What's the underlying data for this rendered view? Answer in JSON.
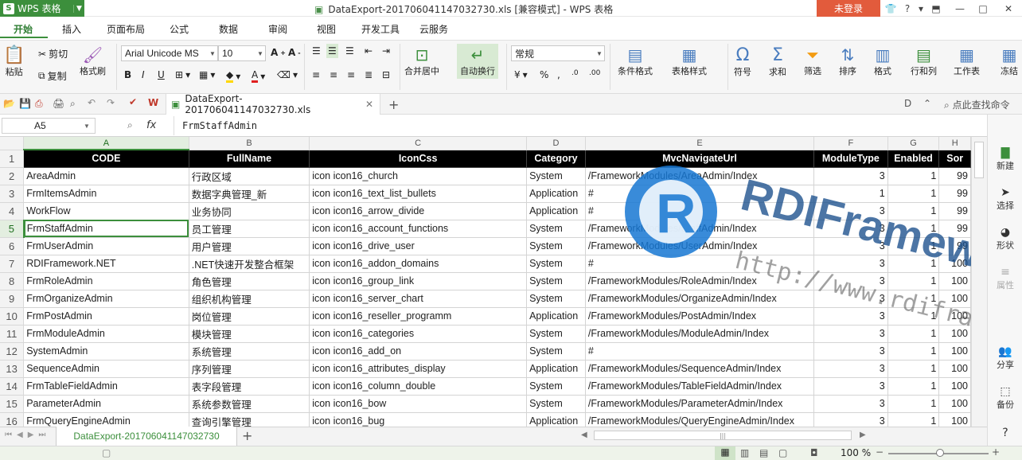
{
  "app": {
    "name": "WPS 表格",
    "title": "DataExport-201706041147032730.xls [兼容模式] - WPS 表格",
    "login": "未登录"
  },
  "ribbon_tabs": [
    "开始",
    "插入",
    "页面布局",
    "公式",
    "数据",
    "审阅",
    "视图",
    "开发工具",
    "云服务"
  ],
  "ribbon": {
    "paste": "粘贴",
    "cut": "剪切",
    "copy": "复制",
    "format_painter": "格式刷",
    "font_name": "Arial Unicode MS",
    "font_size": "10",
    "merge_center": "合并居中",
    "wrap_text": "自动换行",
    "number_format": "常规",
    "conditional_format": "条件格式",
    "table_style": "表格样式",
    "symbol": "符号",
    "sum": "求和",
    "filter": "筛选",
    "sort": "排序",
    "format": "格式",
    "row_col": "行和列",
    "worksheet": "工作表",
    "freeze": "冻结"
  },
  "toolbar": {
    "file_tab": "DataExport-201706041147032730.xls",
    "find_command": "点此查找命令"
  },
  "formula_bar": {
    "cell_ref": "A5",
    "fx": "fx",
    "value": "FrmStaffAdmin"
  },
  "columns": [
    "A",
    "B",
    "C",
    "D",
    "E",
    "F",
    "G",
    "H"
  ],
  "headers": [
    "CODE",
    "FullName",
    "IconCss",
    "Category",
    "MvcNavigateUrl",
    "ModuleType",
    "Enabled",
    "Sor"
  ],
  "rows": [
    [
      "AreaAdmin",
      "行政区域",
      "icon icon16_church",
      "System",
      "/FrameworkModules/AreaAdmin/Index",
      "3",
      "1",
      "99"
    ],
    [
      "FrmItemsAdmin",
      "数据字典管理_新",
      "icon icon16_text_list_bullets",
      "Application",
      "#",
      "1",
      "1",
      "99"
    ],
    [
      "WorkFlow",
      "业务协同",
      "icon icon16_arrow_divide",
      "Application",
      "#",
      "3",
      "1",
      "99"
    ],
    [
      "FrmStaffAdmin",
      "员工管理",
      "icon icon16_account_functions",
      "System",
      "/FrameworkModules/StaffAdmin/Index",
      "3",
      "1",
      "99"
    ],
    [
      "FrmUserAdmin",
      "用户管理",
      "icon icon16_drive_user",
      "System",
      "/FrameworkModules/UserAdmin/Index",
      "3",
      "1",
      "99"
    ],
    [
      "RDIFramework.NET",
      ".NET快速开发整合框架",
      "icon icon16_addon_domains",
      "System",
      "#",
      "3",
      "1",
      "100"
    ],
    [
      "FrmRoleAdmin",
      "角色管理",
      "icon icon16_group_link",
      "System",
      "/FrameworkModules/RoleAdmin/Index",
      "3",
      "1",
      "100"
    ],
    [
      "FrmOrganizeAdmin",
      "组织机构管理",
      "icon icon16_server_chart",
      "System",
      "/FrameworkModules/OrganizeAdmin/Index",
      "3",
      "1",
      "100"
    ],
    [
      "FrmPostAdmin",
      "岗位管理",
      "icon icon16_reseller_programm",
      "Application",
      "/FrameworkModules/PostAdmin/Index",
      "3",
      "1",
      "100"
    ],
    [
      "FrmModuleAdmin",
      "模块管理",
      "icon icon16_categories",
      "System",
      "/FrameworkModules/ModuleAdmin/Index",
      "3",
      "1",
      "100"
    ],
    [
      "SystemAdmin",
      "系统管理",
      "icon icon16_add_on",
      "System",
      "#",
      "3",
      "1",
      "100"
    ],
    [
      "SequenceAdmin",
      "序列管理",
      "icon icon16_attributes_display",
      "Application",
      "/FrameworkModules/SequenceAdmin/Index",
      "3",
      "1",
      "100"
    ],
    [
      "FrmTableFieldAdmin",
      "表字段管理",
      "icon icon16_column_double",
      "System",
      "/FrameworkModules/TableFieldAdmin/Index",
      "3",
      "1",
      "100"
    ],
    [
      "ParameterAdmin",
      "系统参数管理",
      "icon icon16_bow",
      "System",
      "/FrameworkModules/ParameterAdmin/Index",
      "3",
      "1",
      "100"
    ],
    [
      "FrmQueryEngineAdmin",
      "查询引擎管理",
      "icon icon16_bug",
      "Application",
      "/FrameworkModules/QueryEngineAdmin/Index",
      "3",
      "1",
      "100"
    ]
  ],
  "row_numbers": [
    "1",
    "2",
    "3",
    "4",
    "5",
    "6",
    "7",
    "8",
    "9",
    "10",
    "11",
    "12",
    "13",
    "14",
    "15",
    "16"
  ],
  "side_panel": [
    "新建",
    "选择",
    "形状",
    "属性",
    "分享",
    "备份"
  ],
  "sheet_tab": "DataExport-201706041147032730",
  "status": {
    "zoom": "100 %"
  },
  "watermark": {
    "brand": "RDIFramework.NET",
    "url": "http://www.rdiframework.net/"
  },
  "colors": {
    "accent": "#3c8f3c",
    "login": "#e25b3c",
    "header_bg": "#000000"
  }
}
